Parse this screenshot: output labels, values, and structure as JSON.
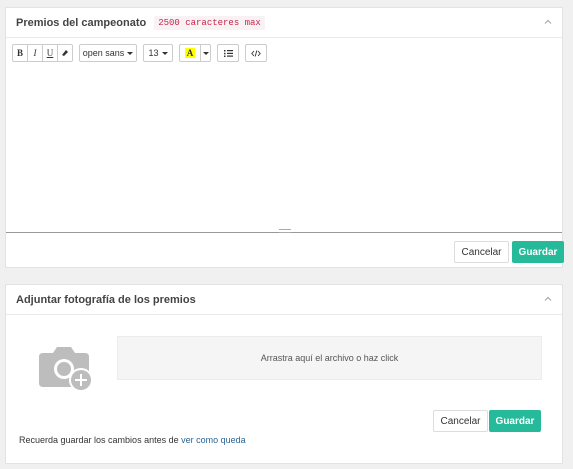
{
  "prizes_panel": {
    "title": "Premios del campeonato",
    "limit_badge": "2500 caracteres max",
    "toolbar": {
      "bold": "B",
      "italic": "I",
      "underline": "U",
      "font_family": "open sans",
      "font_size": "13",
      "highlight": "A",
      "list_icon": "list-icon",
      "code_icon": "code-view-icon"
    },
    "editor_value": "",
    "cancel_label": "Cancelar",
    "save_label": "Guardar"
  },
  "photo_panel": {
    "title": "Adjuntar fotografía de los premios",
    "dropzone_text": "Arrastra aquí el archivo o haz click",
    "cancel_label": "Cancelar",
    "save_label": "Guardar",
    "note_prefix": "Recuerda guardar",
    "note_middle": " los cambios antes de ",
    "note_link": "ver como queda"
  },
  "colors": {
    "accent": "#26b99a",
    "badge_text": "#c7254e",
    "highlight": "#ffff00",
    "link": "#2a6496"
  }
}
